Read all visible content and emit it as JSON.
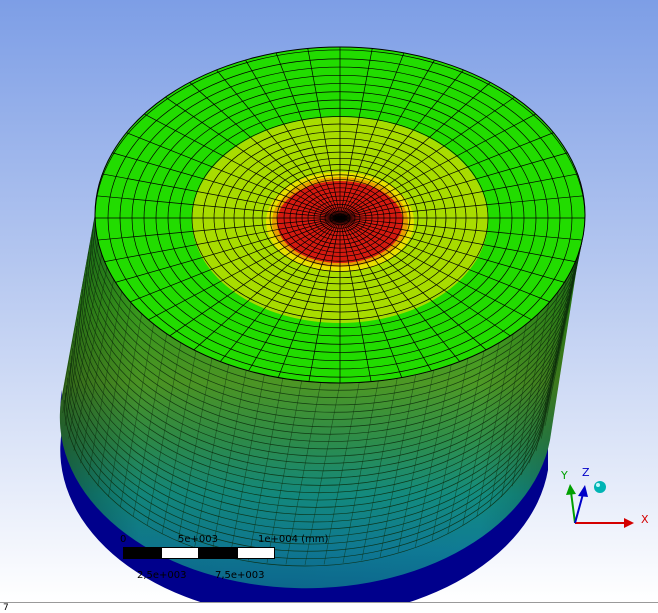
{
  "scale_bar": {
    "tick_0": "0",
    "tick_5e3": "5e+003",
    "tick_1e4": "1e+004 (mm)",
    "tick_2_5e3": "2,5e+003",
    "tick_7_5e3": "7,5e+003"
  },
  "triad": {
    "x_label": "X",
    "y_label": "Y",
    "z_label": "Z",
    "x_color": "#d40000",
    "y_color": "#00a000",
    "z_color": "#0000c8",
    "iso_ball_color": "#00b4b4"
  },
  "colors": {
    "bg_top": "#7d9ee6",
    "bg_bottom": "#ffffff",
    "contour_max": "#d41a10",
    "contour_orange": "#e8a000",
    "contour_yellow": "#e8e000",
    "contour_yellowgreen": "#a8dc00",
    "contour_green": "#22dc00",
    "contour_teal": "#00a0a0",
    "contour_blue": "#00008c"
  },
  "status": {
    "text": "7"
  }
}
